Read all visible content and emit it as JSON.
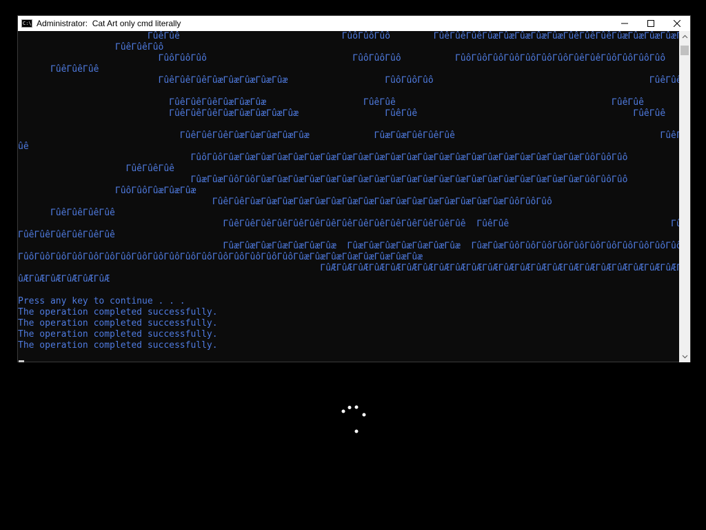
{
  "window": {
    "title": "Administrator:  Cat Art only cmd literally",
    "icon": "cmd-icon",
    "icon_glyph": "C:\\"
  },
  "console": {
    "lines": [
      "                        ΓûêΓûê                              ΓûôΓûôΓûô        ΓûêΓûêΓûêΓûæΓûæΓûæΓûæΓûæΓûêΓûêΓûêΓûæΓûæΓûæΓûæΓûæΓûôΓûôΓûôΓûêΓûê",
      "                  ΓûêΓûêΓûô",
      "                          ΓûôΓûôΓûô                           ΓûôΓûôΓûô          ΓûôΓûôΓûôΓûôΓûôΓûôΓûôΓûêΓûêΓûôΓûôΓûôΓûô",
      "      ΓûêΓûêΓûê",
      "                          ΓûêΓûêΓûêΓûæΓûæΓûæΓûæΓûæ                  ΓûôΓûôΓûô                                        ΓûêΓûê",
      "",
      "                            ΓûêΓûêΓûêΓûæΓûæΓûæ                  ΓûêΓûê                                        ΓûêΓûê",
      "                            ΓûêΓûêΓûêΓûæΓûæΓûæΓûæΓûæ                ΓûêΓûê                                        ΓûêΓûê",
      "",
      "                              ΓûêΓûêΓûêΓûæΓûæΓûæΓûæΓûæ            ΓûæΓûæΓûêΓûêΓûê                                      ΓûêΓ",
      "ûê",
      "                                ΓûôΓûôΓûæΓûæΓûæΓûæΓûæΓûæΓûæΓûæΓûæΓûæΓûæΓûæΓûæΓûæΓûæΓûæΓûæΓûæΓûæΓûæΓûæΓûæΓûôΓûôΓûô",
      "                    ΓûêΓûêΓûê",
      "                                ΓûæΓûæΓûôΓûôΓûæΓûæΓûæΓûæΓûæΓûæΓûæΓûæΓûæΓûæΓûæΓûæΓûæΓûæΓûæΓûæΓûæΓûæΓûæΓûæΓûôΓûôΓûô",
      "                  ΓûôΓûôΓûæΓûæΓûæ",
      "                                    ΓûêΓûêΓûæΓûæΓûæΓûæΓûæΓûæΓûæΓûæΓûæΓûæΓûæΓûæΓûæΓûæΓûæΓûæΓûôΓûôΓûô",
      "      ΓûêΓûêΓûêΓûê",
      "                                      ΓûêΓûêΓûêΓûêΓûêΓûêΓûêΓûêΓûêΓûêΓûêΓûêΓûêΓûêΓûê  ΓûêΓûê                              ΓûêΓûê",
      "ΓûêΓûêΓûêΓûêΓûêΓûê",
      "                                      ΓûæΓûæΓûæΓûæΓûæΓûæΓûæ  ΓûæΓûæΓûæΓûæΓûæΓûæΓûæ  ΓûæΓûæΓûôΓûôΓûôΓûôΓûôΓûôΓûôΓûôΓûôΓûôΓûôΓûôΓûôΓûôΓûôΓûô",
      "ΓûôΓûôΓûôΓûôΓûôΓûôΓûôΓûôΓûôΓûôΓûôΓûôΓûôΓûôΓûôΓûôΓûôΓûæΓûæΓûæΓûæΓûæΓûæΓûæΓûæ",
      "                                                        ΓûÆΓûÆΓûÆΓûÆΓûÆΓûÆΓûÆΓûÆΓûÆΓûÆΓûÆΓûÆΓûÆΓûÆΓûÆΓûÆΓûÆΓûÆΓûÆΓûÆΓûÆΓûÆΓûÆΓûÆΓûÆΓûÆΓûÆΓûÆΓûÆΓûÆΓûÆΓûÆΓûÆΓûÆΓûÆ",
      "ûÆΓûÆΓûÆΓûÆΓûÆΓûÆ",
      "",
      "Press any key to continue . . .",
      "The operation completed successfully.",
      "The operation completed successfully.",
      "The operation completed successfully.",
      "The operation completed successfully."
    ]
  },
  "colors": {
    "console_text": "#4f7be0",
    "console_bg": "#0c0c0c",
    "desktop_bg": "#000000"
  }
}
